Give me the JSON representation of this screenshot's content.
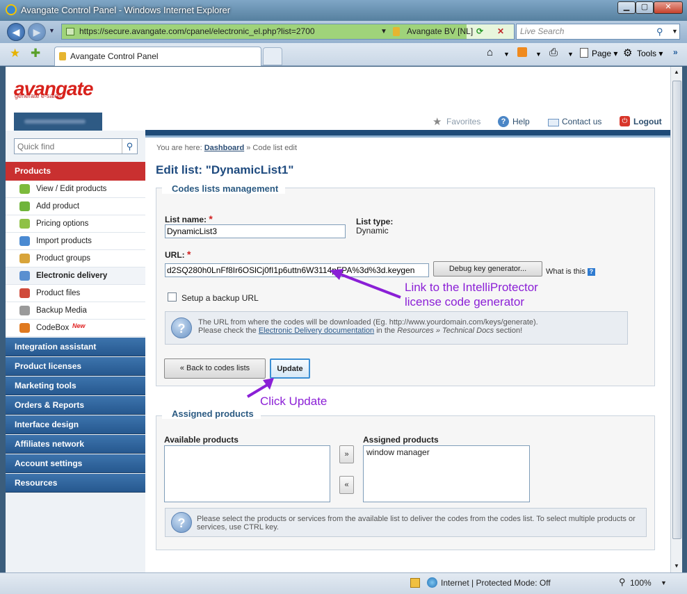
{
  "window": {
    "title": "Avangate Control Panel - Windows Internet Explorer",
    "min": "▁",
    "max": "▢",
    "close": "✕"
  },
  "browser": {
    "url": "https://secure.avangate.com/cpanel/electronic_el.php?list=2700",
    "cert": "Avangate BV [NL]",
    "search_placeholder": "Live Search",
    "tab_title": "Avangate Control Panel",
    "cmd_page": "Page",
    "cmd_tools": "Tools"
  },
  "status": {
    "zone": "Internet | Protected Mode: Off",
    "zoom": "100%"
  },
  "header": {
    "logo": "avangate",
    "tagline": "generate e-sales",
    "favorites": "Favorites",
    "help": "Help",
    "contact": "Contact us",
    "logout": "Logout"
  },
  "sidebar": {
    "quickfind_placeholder": "Quick find",
    "products_label": "Products",
    "product_items": [
      {
        "label": "View / Edit products",
        "color": "#7dbb3c"
      },
      {
        "label": "Add product",
        "color": "#6fb43a"
      },
      {
        "label": "Pricing options",
        "color": "#8fc146"
      },
      {
        "label": "Import products",
        "color": "#4a8ad2"
      },
      {
        "label": "Product groups",
        "color": "#d8a43a"
      },
      {
        "label": "Electronic delivery",
        "color": "#5a8fd0"
      },
      {
        "label": "Product files",
        "color": "#d04a3a"
      },
      {
        "label": "Backup Media",
        "color": "#9a9a9a"
      },
      {
        "label": "CodeBox",
        "color": "#e07a20",
        "badge": "New"
      }
    ],
    "sections": [
      "Integration assistant",
      "Product licenses",
      "Marketing tools",
      "Orders & Reports",
      "Interface design",
      "Affiliates network",
      "Account settings",
      "Resources"
    ]
  },
  "main": {
    "breadcrumb_prefix": "You are here:",
    "breadcrumb_link": "Dashboard",
    "breadcrumb_current": "» Code list edit",
    "title": "Edit list: \"DynamicList1\"",
    "codes_legend": "Codes lists management",
    "list_name_label": "List name:",
    "list_name_value": "DynamicList3",
    "list_type_label": "List type:",
    "list_type_value": "Dynamic",
    "url_label": "URL:",
    "url_value": "d2SQ280h0LnFf8Ir6OSlCj0fI1p6uttn6W3114pFPA%3d%3d.keygen",
    "debug_btn": "Debug key generator...",
    "what_is_this": "What is this",
    "backup_label": "Setup a backup URL",
    "info1_line1": "The URL from where the codes will be downloaded (Eg. http://www.yourdomain.com/keys/generate).",
    "info1_pre": "Please check the ",
    "info1_link": "Electronic Delivery documentation",
    "info1_mid": " in the ",
    "info1_italic": "Resources » Technical Docs",
    "info1_post": " section!",
    "back_btn": "« Back to codes lists",
    "update_btn": "Update",
    "annot_link_line1": "Link to the IntelliProtector",
    "annot_link_line2": "license code generator",
    "annot_update": "Click Update",
    "assigned_legend": "Assigned products",
    "available_label": "Available products",
    "assigned_label": "Assigned products",
    "assigned_items": [
      "window manager"
    ],
    "move_right": "»",
    "move_left": "«",
    "info2": "Please select the products or services from the available list to deliver the codes from the codes list. To select multiple products or services, use CTRL key."
  }
}
